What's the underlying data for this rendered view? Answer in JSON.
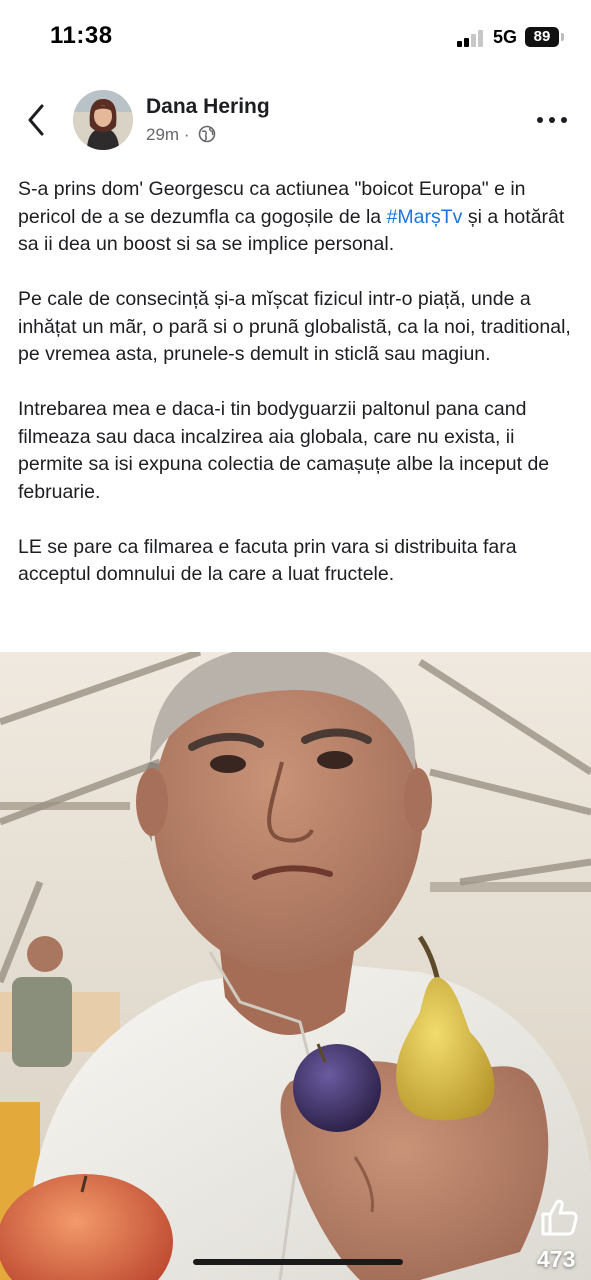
{
  "status_bar": {
    "time": "11:38",
    "network": "5G",
    "battery": "89"
  },
  "post": {
    "author": "Dana Hering",
    "time_ago": "29m",
    "separator": "·",
    "privacy_icon": "globe-icon",
    "paragraphs": [
      {
        "before": "S-a prins dom' Georgescu ca actiunea \"boicot Europa\" e in pericol de a se dezumfla ca gogoșile de la ",
        "hashtag": "#MarșTv",
        "after": " și a hotărât sa ii dea un boost si sa se implice personal."
      },
      {
        "before": "Pe cale de consecință și-a mĭșcat fizicul intr-o piață, unde a inhățat un mãr, o parã si o prunã globalistã, ca la noi, traditional, pe vremea asta,  prunele-s demult in sticlã sau magiun.",
        "hashtag": "",
        "after": ""
      },
      {
        "before": "Intrebarea mea e daca-i tin bodyguarzii paltonul pana cand filmeaza sau daca incalzirea aia globala, care nu exista, ii permite sa isi expuna colectia de camașuțe albe la inceput de februarie.",
        "hashtag": "",
        "after": ""
      },
      {
        "before": "LE se pare ca filmarea e facuta prin vara si distribuita fara acceptul domnului de la care a luat fructele.",
        "hashtag": "",
        "after": ""
      }
    ],
    "like_count": "473"
  },
  "colors": {
    "hashtag": "#1b74e4",
    "meta_text": "#65676b",
    "text": "#1c1e21"
  }
}
